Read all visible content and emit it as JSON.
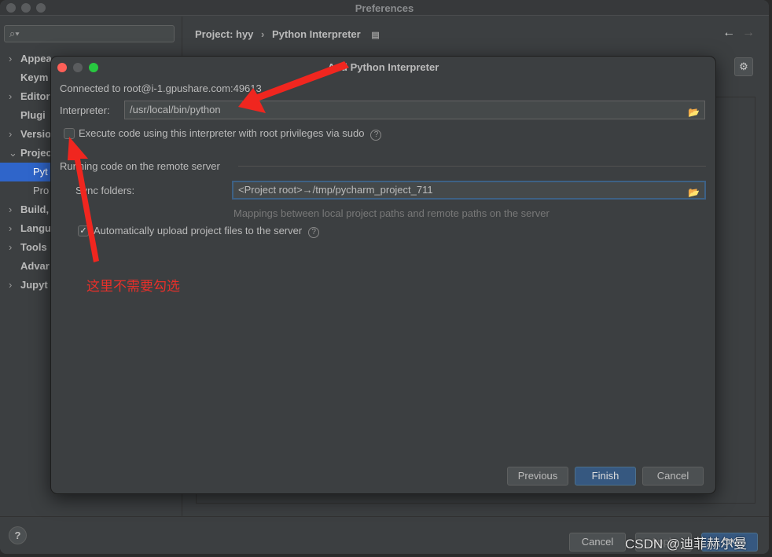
{
  "window": {
    "title": "Preferences"
  },
  "sidebar": {
    "search_placeholder": "",
    "items": [
      {
        "label": "Appea",
        "chevron": "›"
      },
      {
        "label": "Keym",
        "chevron": ""
      },
      {
        "label": "Editor",
        "chevron": "›"
      },
      {
        "label": "Plugi",
        "chevron": ""
      },
      {
        "label": "Versio",
        "chevron": "›"
      },
      {
        "label": "Projec",
        "chevron": "⌄"
      },
      {
        "label": "Pyt",
        "chevron": "",
        "selected": true,
        "sub": true
      },
      {
        "label": "Pro",
        "chevron": "",
        "sub": true
      },
      {
        "label": "Build,",
        "chevron": "›"
      },
      {
        "label": "Langu",
        "chevron": "›"
      },
      {
        "label": "Tools",
        "chevron": "›"
      },
      {
        "label": "Advar",
        "chevron": ""
      },
      {
        "label": "Jupyt",
        "chevron": "›"
      }
    ]
  },
  "main": {
    "breadcrumb": [
      "Project: hyy",
      "Python Interpreter"
    ],
    "back": "←",
    "forward": "→"
  },
  "footer": {
    "help": "?",
    "cancel": "Cancel",
    "apply": "Apply",
    "ok": "OK"
  },
  "dialog": {
    "title": "Add Python Interpreter",
    "connected": "Connected to root@i-1.gpushare.com:49613",
    "interpreter_label": "Interpreter:",
    "interpreter_value": "/usr/local/bin/python",
    "sudo_label": "Execute code using this interpreter with root privileges via sudo",
    "sudo_checked": false,
    "section": "Running code on the remote server",
    "sync_label": "Sync folders:",
    "sync_value": "<Project root>→/tmp/pycharm_project_711",
    "sync_hint": "Mappings between local project paths and remote paths on the server",
    "upload_label": "Automatically upload project files to the server",
    "upload_checked": true,
    "previous": "Previous",
    "finish": "Finish",
    "cancel": "Cancel"
  },
  "annotation": {
    "text": "这里不需要勾选",
    "color": "#e8302a"
  },
  "watermark": "CSDN @迪菲赫尔曼",
  "colors": {
    "accent": "#2f65ca",
    "primary_button": "#365880",
    "arrow": "#f0261f"
  }
}
